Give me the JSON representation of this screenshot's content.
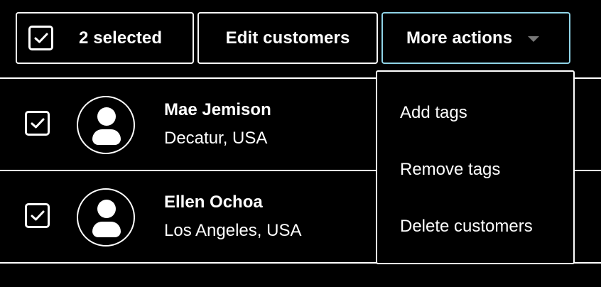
{
  "bulk_actions": {
    "selected_label": "2 selected",
    "edit_label": "Edit customers",
    "more_label": "More actions"
  },
  "customers": [
    {
      "name": "Mae Jemison",
      "location": "Decatur, USA",
      "checked": true
    },
    {
      "name": "Ellen Ochoa",
      "location": "Los Angeles, USA",
      "checked": true
    }
  ],
  "menu": {
    "items": [
      {
        "label": "Add tags"
      },
      {
        "label": "Remove tags"
      },
      {
        "label": "Delete customers"
      }
    ]
  },
  "colors": {
    "background": "#000000",
    "foreground": "#ffffff",
    "focus_ring": "#8fd3e6",
    "caret": "#777777"
  }
}
